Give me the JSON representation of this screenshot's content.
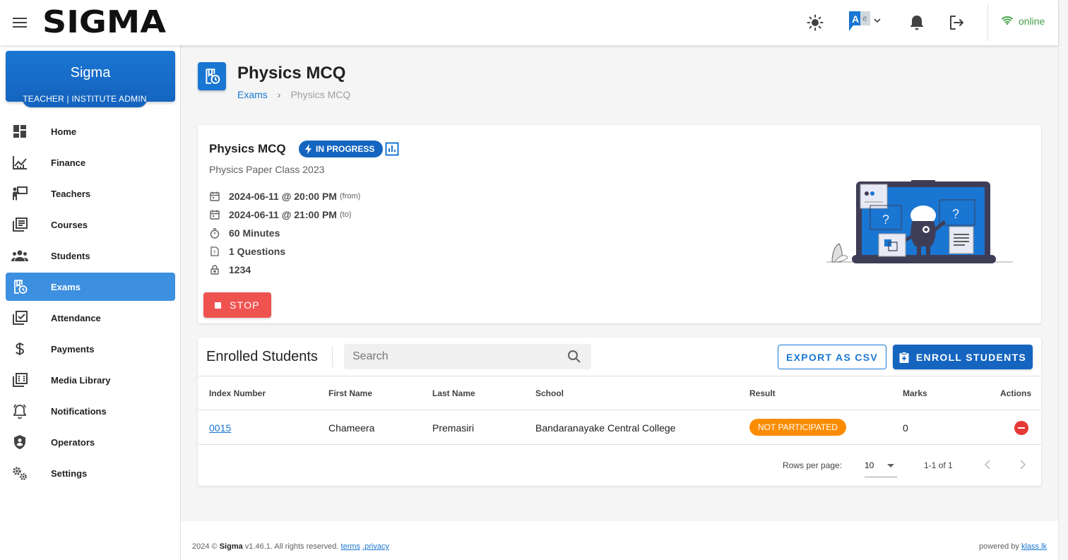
{
  "app": {
    "logo": "SIGMA",
    "status": "online",
    "colors": {
      "primary": "#1976d2",
      "active_nav": "#3d8fe0",
      "danger": "#ef5350",
      "warning": "#fb8c00",
      "online": "#43a047"
    }
  },
  "sidebar": {
    "brand_name": "Sigma",
    "role": "TEACHER | INSTITUTE ADMIN",
    "items": [
      {
        "label": "Home",
        "icon": "dashboard-icon"
      },
      {
        "label": "Finance",
        "icon": "finance-chart-icon"
      },
      {
        "label": "Teachers",
        "icon": "teacher-icon"
      },
      {
        "label": "Courses",
        "icon": "courses-icon"
      },
      {
        "label": "Students",
        "icon": "students-icon"
      },
      {
        "label": "Exams",
        "icon": "exam-icon",
        "active": true
      },
      {
        "label": "Attendance",
        "icon": "attendance-icon"
      },
      {
        "label": "Payments",
        "icon": "dollar-icon"
      },
      {
        "label": "Media Library",
        "icon": "media-library-icon"
      },
      {
        "label": "Notifications",
        "icon": "bell-ring-icon"
      },
      {
        "label": "Operators",
        "icon": "shield-icon"
      },
      {
        "label": "Settings",
        "icon": "cogs-icon"
      }
    ]
  },
  "page": {
    "title": "Physics MCQ",
    "breadcrumb": {
      "parent": "Exams",
      "separator": "›",
      "current": "Physics MCQ"
    }
  },
  "exam": {
    "title": "Physics MCQ",
    "status": "IN PROGRESS",
    "subtitle": "Physics Paper Class 2023",
    "from": "2024-06-11 @ 20:00 PM",
    "from_suffix": "(from)",
    "to": "2024-06-11 @ 21:00 PM",
    "to_suffix": "(to)",
    "duration": "60 Minutes",
    "questions": "1 Questions",
    "password": "1234",
    "stop_label": "STOP"
  },
  "students": {
    "title": "Enrolled Students",
    "search_placeholder": "Search",
    "export_label": "EXPORT AS CSV",
    "enroll_label": "ENROLL STUDENTS",
    "columns": [
      "Index Number",
      "First Name",
      "Last Name",
      "School",
      "Result",
      "Marks",
      "Actions"
    ],
    "rows": [
      {
        "index": "0015",
        "first": "Chameera",
        "last": "Premasiri",
        "school": "Bandaranayake Central College",
        "result": "NOT PARTICIPATED",
        "marks": "0"
      }
    ],
    "rows_per_page_label": "Rows per page:",
    "rows_per_page": "10",
    "range": "1-1 of 1"
  },
  "footer": {
    "year": "2024 ©",
    "brand": "Sigma",
    "version": "v1.46.1. All rights reserved.",
    "terms": "terms",
    "privacy": ".privacy",
    "powered_by": "powered by",
    "powered_link": "klass.lk"
  }
}
